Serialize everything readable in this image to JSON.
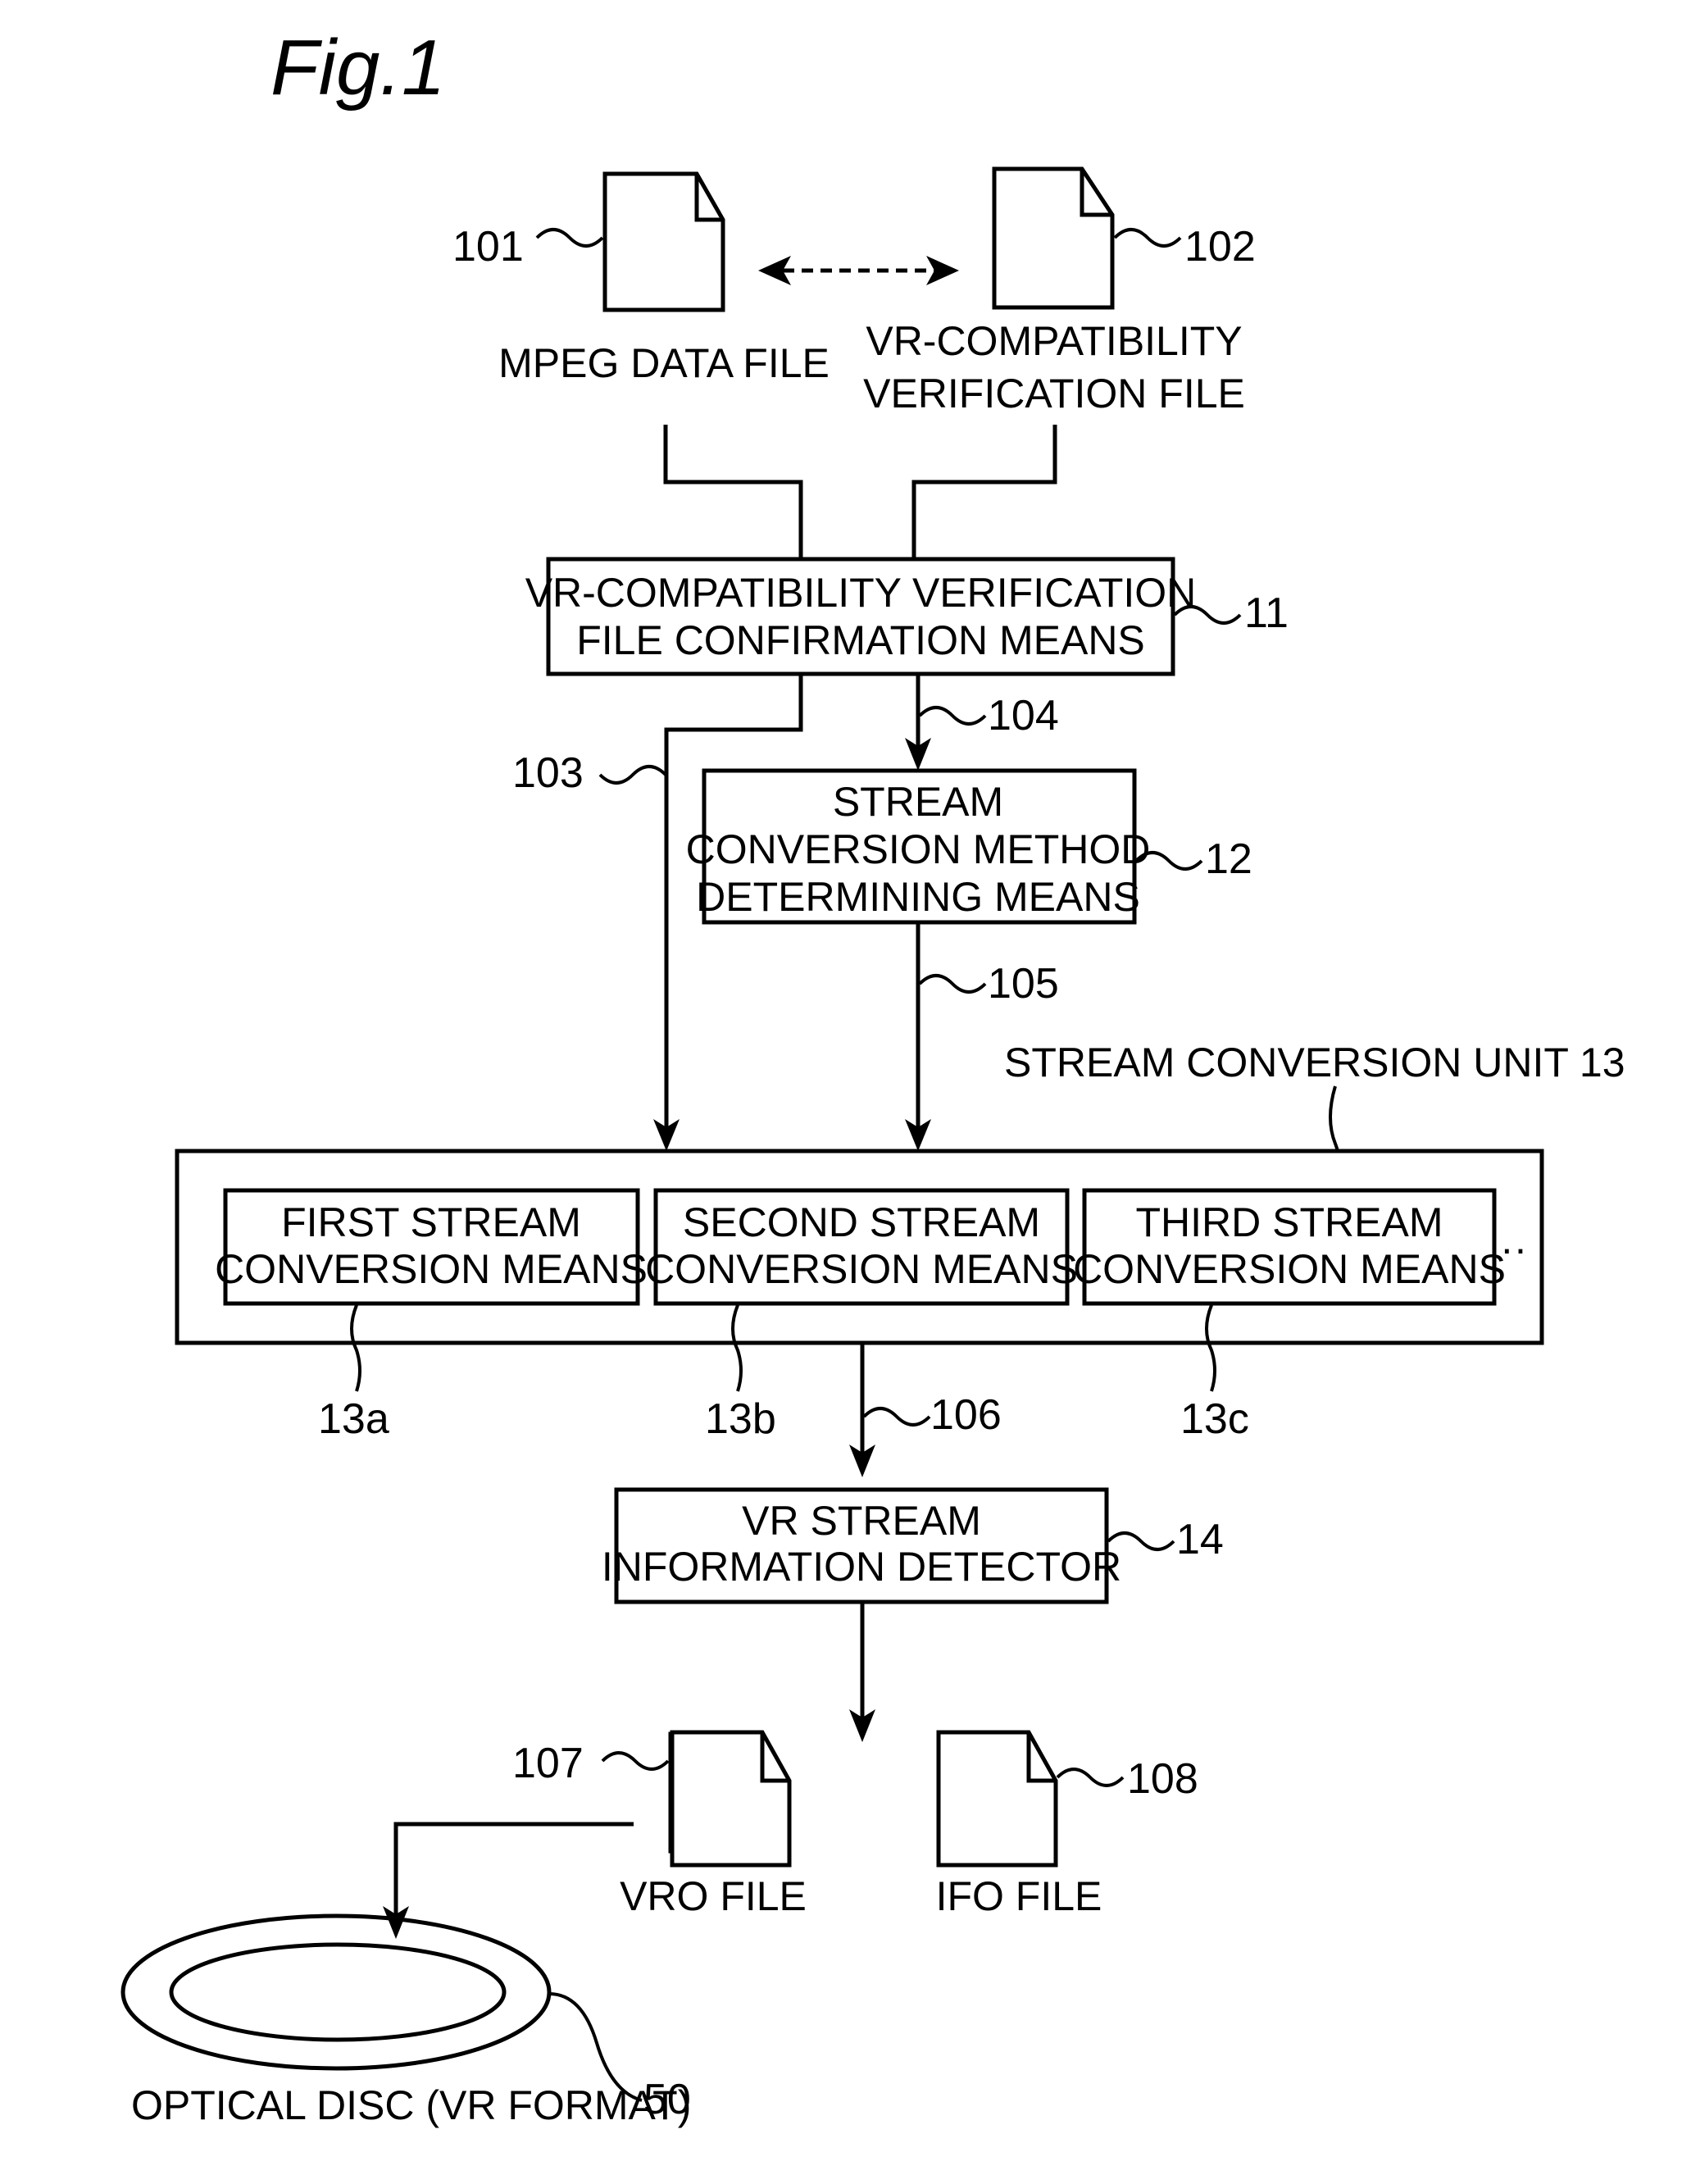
{
  "figure": {
    "title": "Fig.1",
    "files": {
      "mpeg": {
        "ref": "101",
        "label": "MPEG DATA FILE"
      },
      "vr_verification": {
        "ref": "102",
        "label_line1": "VR-COMPATIBILITY",
        "label_line2": "VERIFICATION FILE"
      },
      "vro": {
        "ref": "107",
        "label": "VRO FILE"
      },
      "ifo": {
        "ref": "108",
        "label": "IFO FILE"
      }
    },
    "blocks": {
      "confirmation": {
        "ref": "11",
        "line1": "VR-COMPATIBILITY VERIFICATION",
        "line2": "FILE CONFIRMATION MEANS"
      },
      "method": {
        "ref": "12",
        "line1": "STREAM",
        "line2": "CONVERSION METHOD",
        "line3": "DETERMINING MEANS"
      },
      "unit": {
        "label": "STREAM CONVERSION UNIT 13"
      },
      "first": {
        "ref": "13a",
        "line1": "FIRST STREAM",
        "line2": "CONVERSION MEANS"
      },
      "second": {
        "ref": "13b",
        "line1": "SECOND STREAM",
        "line2": "CONVERSION MEANS"
      },
      "third": {
        "ref": "13c",
        "line1": "THIRD STREAM",
        "line2": "CONVERSION MEANS"
      },
      "ellipsis": "··",
      "detector": {
        "ref": "14",
        "line1": "VR STREAM",
        "line2": "INFORMATION DETECTOR"
      }
    },
    "signals": {
      "s103": "103",
      "s104": "104",
      "s105": "105",
      "s106": "106"
    },
    "disc": {
      "ref": "50",
      "label": "OPTICAL DISC (VR FORMAT)"
    }
  }
}
